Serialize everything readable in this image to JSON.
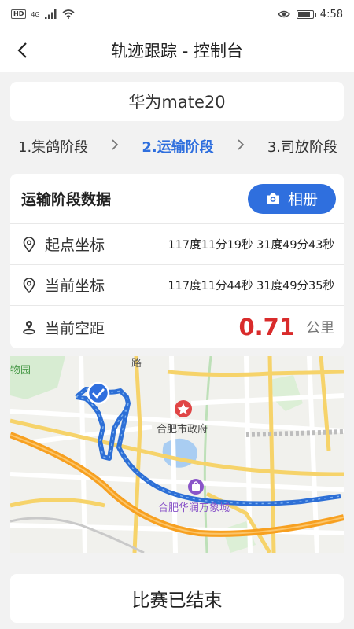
{
  "status_bar": {
    "network_badge": "HD",
    "network_type": "4G",
    "time": "4:58",
    "battery_level": 0.9
  },
  "header": {
    "title": "轨迹跟踪 - 控制台",
    "back_icon": "chevron-left-icon"
  },
  "device": {
    "name": "华为mate20"
  },
  "stages": {
    "items": [
      {
        "label": "1.集鸽阶段",
        "active": false
      },
      {
        "label": "2.运输阶段",
        "active": true
      },
      {
        "label": "3.司放阶段",
        "active": false
      }
    ],
    "separator_icon": "chevron-right-icon"
  },
  "transport_data": {
    "title": "运输阶段数据",
    "album_label": "相册",
    "album_icon": "camera-icon",
    "start_coord": {
      "label": "起点坐标",
      "value": "117度11分19秒 31度49分43秒",
      "icon": "location-pin-icon"
    },
    "current_coord": {
      "label": "当前坐标",
      "value": "117度11分44秒 31度49分35秒",
      "icon": "location-pin-icon"
    },
    "distance": {
      "label": "当前空距",
      "value": "0.71",
      "unit": "公里",
      "icon": "distance-pin-icon"
    }
  },
  "map": {
    "labels": {
      "park": "物园",
      "road": "路",
      "city_gov": "合肥市政府",
      "mall": "合肥华润万象城"
    },
    "colors": {
      "route": "#3a7bd5",
      "gov_marker": "#e04545",
      "mall_marker": "#8a55c9",
      "highway": "#f7a020"
    }
  },
  "footer": {
    "finish_label": "比赛已结束"
  },
  "colors": {
    "accent": "#2f6fde",
    "distance": "#d92b2b"
  }
}
